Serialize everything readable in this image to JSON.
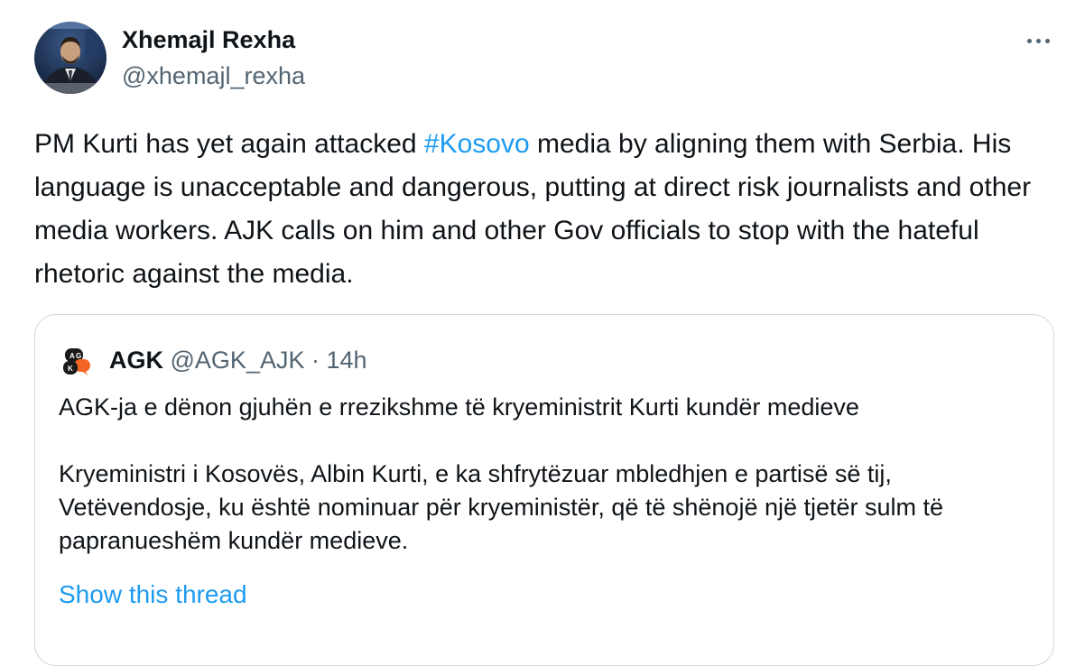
{
  "tweet": {
    "author": {
      "name": "Xhemajl Rexha",
      "handle": "@xhemajl_rexha",
      "avatar_icon": "profile-photo"
    },
    "more_icon": "more-horizontal-icon",
    "text_before": "PM Kurti has yet again attacked ",
    "hashtag": "#Kosovo",
    "text_after": " media by aligning them with Serbia. His language is unacceptable and dangerous, putting at direct risk journalists and other media workers. AJK calls on him and other Gov officials to stop with the hateful rhetoric against the media."
  },
  "quote": {
    "name": "AGK",
    "handle": "@AGK_AJK",
    "separator": "·",
    "time": "14h",
    "avatar_icon": "agk-logo",
    "avatar_letters": [
      "A",
      "G",
      "K"
    ],
    "text": "AGK-ja e dënon gjuhën e rrezikshme të kryeministrit Kurti kundër medieve\n\nKryeministri i Kosovës, Albin Kurti, e ka shfrytëzuar mbledhjen e partisë së tij, Vetëvendosje, ku është nominuar për kryeministër, që të shënojë një tjetër sulm të papranueshëm kundër medieve.",
    "show_thread": "Show this thread"
  },
  "colors": {
    "text": "#0f1419",
    "secondary": "#536471",
    "link": "#1d9bf0",
    "border": "#cfd9de",
    "logo_orange": "#f26522"
  }
}
